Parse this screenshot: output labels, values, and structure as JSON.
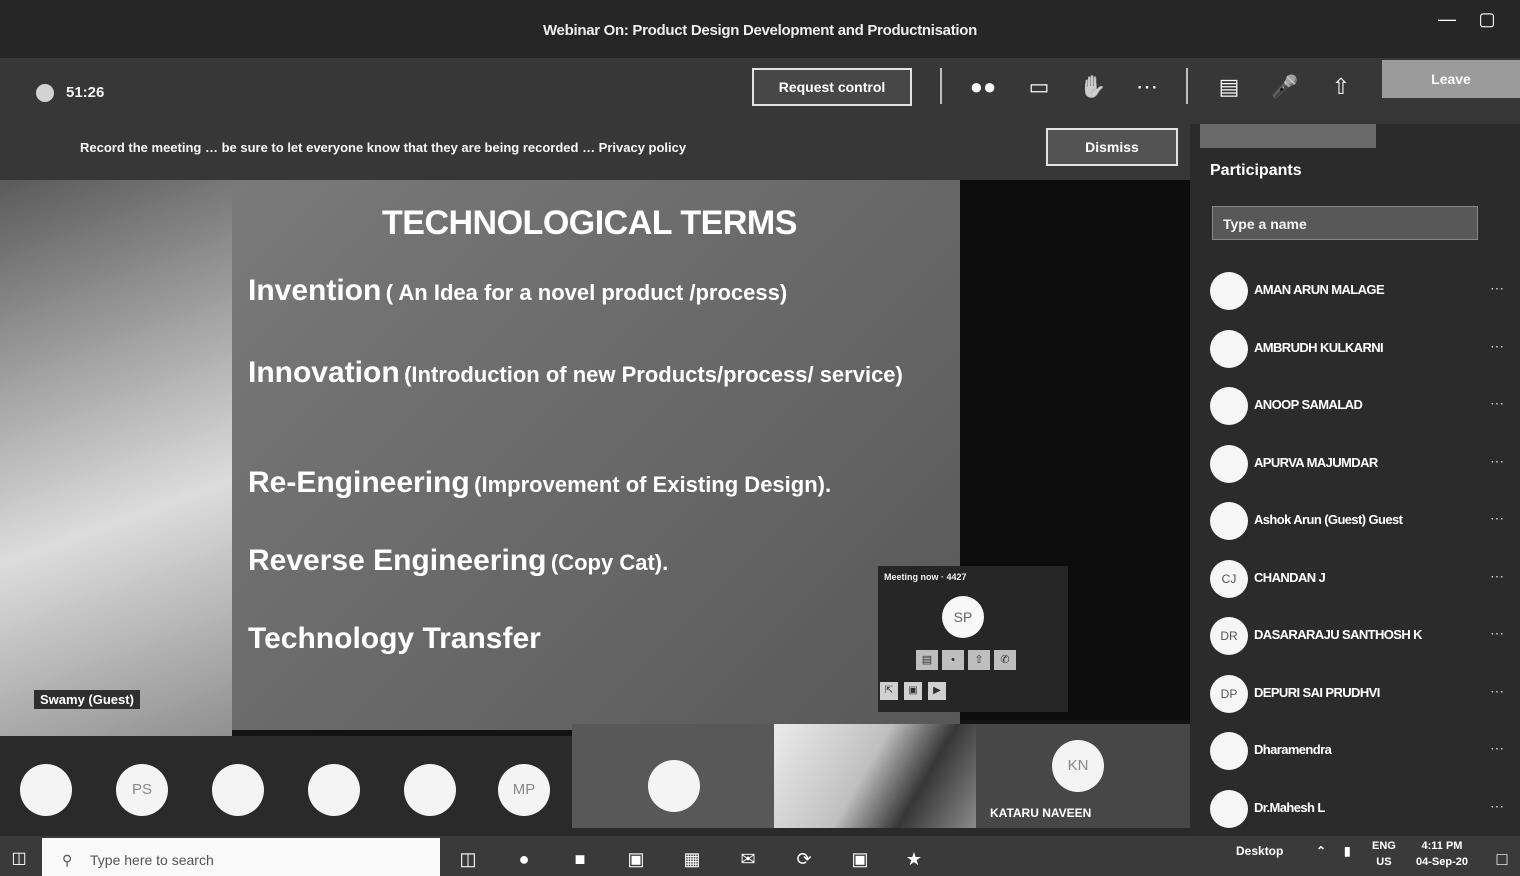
{
  "window": {
    "title": "Webinar On: Product Design Development and Productnisation",
    "minimize_icon": "—",
    "restore_icon": "▢"
  },
  "toolbar": {
    "timer": "51:26",
    "request_control": "Request control",
    "icons": [
      "participants-icon",
      "chat-icon",
      "raise-hand-icon",
      "more-options-icon",
      "camera-off-icon",
      "mic-off-icon",
      "share-icon"
    ],
    "leave_label": "Leave"
  },
  "notice": {
    "text": "Record the meeting … be sure to let everyone know that they are being recorded … Privacy policy",
    "dismiss": "Dismiss"
  },
  "slide": {
    "heading": "TECHNOLOGICAL TERMS",
    "terms": [
      {
        "term": "Invention",
        "desc": "( An Idea for a novel product /process)"
      },
      {
        "term": "Innovation",
        "desc": "(Introduction of new Products/process/ service)"
      },
      {
        "term": "Re-Engineering",
        "desc": "(Improvement of Existing Design)."
      },
      {
        "term": "Reverse Engineering",
        "desc": "(Copy Cat)."
      },
      {
        "term": "Technology Transfer",
        "desc": ""
      }
    ]
  },
  "left_video": {
    "name": "Swamy (Guest)"
  },
  "minicall": {
    "label": "Meeting now · 4427",
    "avatar": "SP"
  },
  "participants": {
    "heading": "Participants",
    "search_placeholder": "Type a name",
    "items": [
      {
        "initials": "",
        "name": "AMAN ARUN MALAGE"
      },
      {
        "initials": "",
        "name": "AMBRUDH KULKARNI"
      },
      {
        "initials": "",
        "name": "ANOOP SAMALAD"
      },
      {
        "initials": "",
        "name": "APURVA MAJUMDAR"
      },
      {
        "initials": "",
        "name": "Ashok Arun (Guest) Guest"
      },
      {
        "initials": "CJ",
        "name": "CHANDAN J"
      },
      {
        "initials": "DR",
        "name": "DASARARAJU SANTHOSH K"
      },
      {
        "initials": "DP",
        "name": "DEPURI SAI PRUDHVI"
      },
      {
        "initials": "",
        "name": "Dharamendra"
      },
      {
        "initials": "",
        "name": "Dr.Mahesh L"
      }
    ]
  },
  "strip": {
    "avatars": [
      "",
      "PS",
      "",
      "",
      "",
      "MP",
      ""
    ],
    "tile_name": "KATARU NAVEEN",
    "tile_initials": "KN"
  },
  "taskbar": {
    "search_placeholder": "Type here to search",
    "desktop": "Desktop",
    "lang": "ENG",
    "region": "US",
    "time": "4:11 PM",
    "date": "04-Sep-20"
  }
}
